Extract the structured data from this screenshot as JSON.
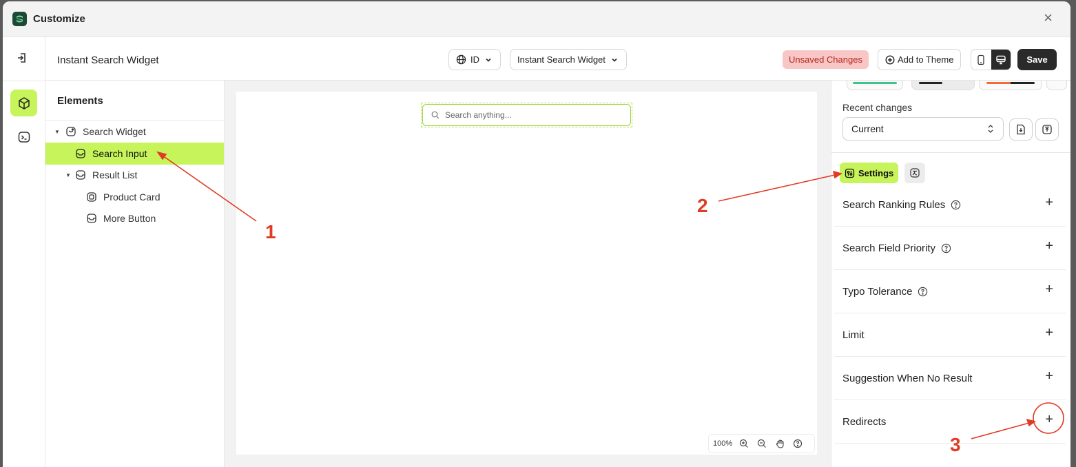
{
  "window": {
    "title": "Customize"
  },
  "header": {
    "title": "Instant Search Widget",
    "language": "ID",
    "widget_select": "Instant Search Widget",
    "unsaved": "Unsaved Changes",
    "add_to_theme": "Add to Theme",
    "save": "Save"
  },
  "elements": {
    "title": "Elements",
    "tree": [
      {
        "label": "Search Widget",
        "icon": "widget-icon"
      },
      {
        "label": "Search Input",
        "icon": "input-icon"
      },
      {
        "label": "Result List",
        "icon": "list-icon"
      },
      {
        "label": "Product Card",
        "icon": "card-icon"
      },
      {
        "label": "More Button",
        "icon": "button-icon"
      }
    ]
  },
  "canvas": {
    "search_placeholder": "Search anything...",
    "zoom": "100%"
  },
  "right_panel": {
    "recent_changes_label": "Recent changes",
    "recent_changes_value": "Current",
    "tab_settings": "Settings",
    "sections": [
      {
        "label": "Search Ranking Rules",
        "help": true
      },
      {
        "label": "Search Field Priority",
        "help": true
      },
      {
        "label": "Typo Tolerance",
        "help": true
      },
      {
        "label": "Limit",
        "help": false
      },
      {
        "label": "Suggestion When No Result",
        "help": false
      },
      {
        "label": "Redirects",
        "help": false
      }
    ]
  },
  "annotations": {
    "n1": "1",
    "n2": "2",
    "n3": "3"
  },
  "colors": {
    "accent": "#c6f45a",
    "annotation": "#e13b24",
    "unsaved_bg": "#f8c7c5",
    "dark": "#2a2a2a"
  }
}
